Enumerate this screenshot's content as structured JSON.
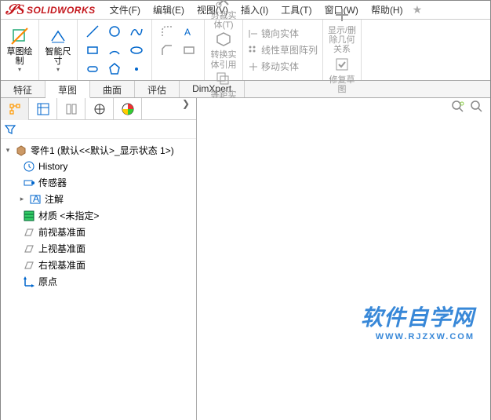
{
  "app": {
    "name": "SOLIDWORKS"
  },
  "menu": {
    "file": "文件(F)",
    "edit": "编辑(E)",
    "view": "视图(V)",
    "insert": "插入(I)",
    "tools": "工具(T)",
    "window": "窗口(W)",
    "help": "帮助(H)",
    "star": "★"
  },
  "ribbon": {
    "sketch": "草图绘制",
    "smartdim": "智能尺寸",
    "trim": "剪裁实体(T)",
    "convert": "转换实体引用",
    "offset": "等距实体",
    "mirror": "镜向实体",
    "pattern": "线性草图阵列",
    "move": "移动实体",
    "display": "显示/删除几何关系",
    "repair": "修复草图"
  },
  "tabs": {
    "feature": "特征",
    "sketch": "草图",
    "surface": "曲面",
    "evaluate": "评估",
    "dimxpert": "DimXpert"
  },
  "tree": {
    "root": "零件1 (默认<<默认>_显示状态 1>)",
    "history": "History",
    "sensor": "传感器",
    "annot": "注解",
    "material": "材质 <未指定>",
    "front": "前视基准面",
    "top": "上视基准面",
    "right": "右视基准面",
    "origin": "原点"
  },
  "watermark": {
    "line1": "软件自学网",
    "line2": "WWW.RJZXW.COM"
  }
}
